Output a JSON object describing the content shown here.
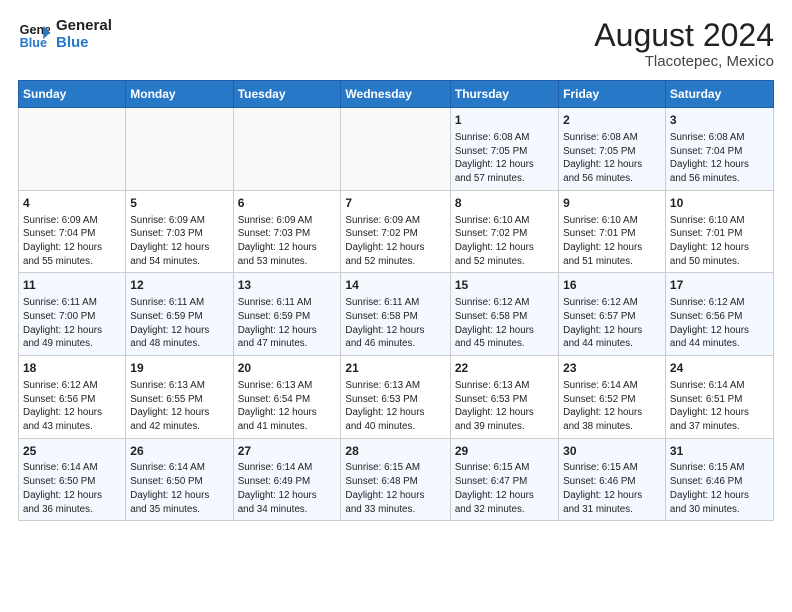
{
  "header": {
    "logo_line1": "General",
    "logo_line2": "Blue",
    "month_year": "August 2024",
    "location": "Tlacotepec, Mexico"
  },
  "weekdays": [
    "Sunday",
    "Monday",
    "Tuesday",
    "Wednesday",
    "Thursday",
    "Friday",
    "Saturday"
  ],
  "weeks": [
    [
      {
        "day": "",
        "info": ""
      },
      {
        "day": "",
        "info": ""
      },
      {
        "day": "",
        "info": ""
      },
      {
        "day": "",
        "info": ""
      },
      {
        "day": "1",
        "info": "Sunrise: 6:08 AM\nSunset: 7:05 PM\nDaylight: 12 hours\nand 57 minutes."
      },
      {
        "day": "2",
        "info": "Sunrise: 6:08 AM\nSunset: 7:05 PM\nDaylight: 12 hours\nand 56 minutes."
      },
      {
        "day": "3",
        "info": "Sunrise: 6:08 AM\nSunset: 7:04 PM\nDaylight: 12 hours\nand 56 minutes."
      }
    ],
    [
      {
        "day": "4",
        "info": "Sunrise: 6:09 AM\nSunset: 7:04 PM\nDaylight: 12 hours\nand 55 minutes."
      },
      {
        "day": "5",
        "info": "Sunrise: 6:09 AM\nSunset: 7:03 PM\nDaylight: 12 hours\nand 54 minutes."
      },
      {
        "day": "6",
        "info": "Sunrise: 6:09 AM\nSunset: 7:03 PM\nDaylight: 12 hours\nand 53 minutes."
      },
      {
        "day": "7",
        "info": "Sunrise: 6:09 AM\nSunset: 7:02 PM\nDaylight: 12 hours\nand 52 minutes."
      },
      {
        "day": "8",
        "info": "Sunrise: 6:10 AM\nSunset: 7:02 PM\nDaylight: 12 hours\nand 52 minutes."
      },
      {
        "day": "9",
        "info": "Sunrise: 6:10 AM\nSunset: 7:01 PM\nDaylight: 12 hours\nand 51 minutes."
      },
      {
        "day": "10",
        "info": "Sunrise: 6:10 AM\nSunset: 7:01 PM\nDaylight: 12 hours\nand 50 minutes."
      }
    ],
    [
      {
        "day": "11",
        "info": "Sunrise: 6:11 AM\nSunset: 7:00 PM\nDaylight: 12 hours\nand 49 minutes."
      },
      {
        "day": "12",
        "info": "Sunrise: 6:11 AM\nSunset: 6:59 PM\nDaylight: 12 hours\nand 48 minutes."
      },
      {
        "day": "13",
        "info": "Sunrise: 6:11 AM\nSunset: 6:59 PM\nDaylight: 12 hours\nand 47 minutes."
      },
      {
        "day": "14",
        "info": "Sunrise: 6:11 AM\nSunset: 6:58 PM\nDaylight: 12 hours\nand 46 minutes."
      },
      {
        "day": "15",
        "info": "Sunrise: 6:12 AM\nSunset: 6:58 PM\nDaylight: 12 hours\nand 45 minutes."
      },
      {
        "day": "16",
        "info": "Sunrise: 6:12 AM\nSunset: 6:57 PM\nDaylight: 12 hours\nand 44 minutes."
      },
      {
        "day": "17",
        "info": "Sunrise: 6:12 AM\nSunset: 6:56 PM\nDaylight: 12 hours\nand 44 minutes."
      }
    ],
    [
      {
        "day": "18",
        "info": "Sunrise: 6:12 AM\nSunset: 6:56 PM\nDaylight: 12 hours\nand 43 minutes."
      },
      {
        "day": "19",
        "info": "Sunrise: 6:13 AM\nSunset: 6:55 PM\nDaylight: 12 hours\nand 42 minutes."
      },
      {
        "day": "20",
        "info": "Sunrise: 6:13 AM\nSunset: 6:54 PM\nDaylight: 12 hours\nand 41 minutes."
      },
      {
        "day": "21",
        "info": "Sunrise: 6:13 AM\nSunset: 6:53 PM\nDaylight: 12 hours\nand 40 minutes."
      },
      {
        "day": "22",
        "info": "Sunrise: 6:13 AM\nSunset: 6:53 PM\nDaylight: 12 hours\nand 39 minutes."
      },
      {
        "day": "23",
        "info": "Sunrise: 6:14 AM\nSunset: 6:52 PM\nDaylight: 12 hours\nand 38 minutes."
      },
      {
        "day": "24",
        "info": "Sunrise: 6:14 AM\nSunset: 6:51 PM\nDaylight: 12 hours\nand 37 minutes."
      }
    ],
    [
      {
        "day": "25",
        "info": "Sunrise: 6:14 AM\nSunset: 6:50 PM\nDaylight: 12 hours\nand 36 minutes."
      },
      {
        "day": "26",
        "info": "Sunrise: 6:14 AM\nSunset: 6:50 PM\nDaylight: 12 hours\nand 35 minutes."
      },
      {
        "day": "27",
        "info": "Sunrise: 6:14 AM\nSunset: 6:49 PM\nDaylight: 12 hours\nand 34 minutes."
      },
      {
        "day": "28",
        "info": "Sunrise: 6:15 AM\nSunset: 6:48 PM\nDaylight: 12 hours\nand 33 minutes."
      },
      {
        "day": "29",
        "info": "Sunrise: 6:15 AM\nSunset: 6:47 PM\nDaylight: 12 hours\nand 32 minutes."
      },
      {
        "day": "30",
        "info": "Sunrise: 6:15 AM\nSunset: 6:46 PM\nDaylight: 12 hours\nand 31 minutes."
      },
      {
        "day": "31",
        "info": "Sunrise: 6:15 AM\nSunset: 6:46 PM\nDaylight: 12 hours\nand 30 minutes."
      }
    ]
  ]
}
